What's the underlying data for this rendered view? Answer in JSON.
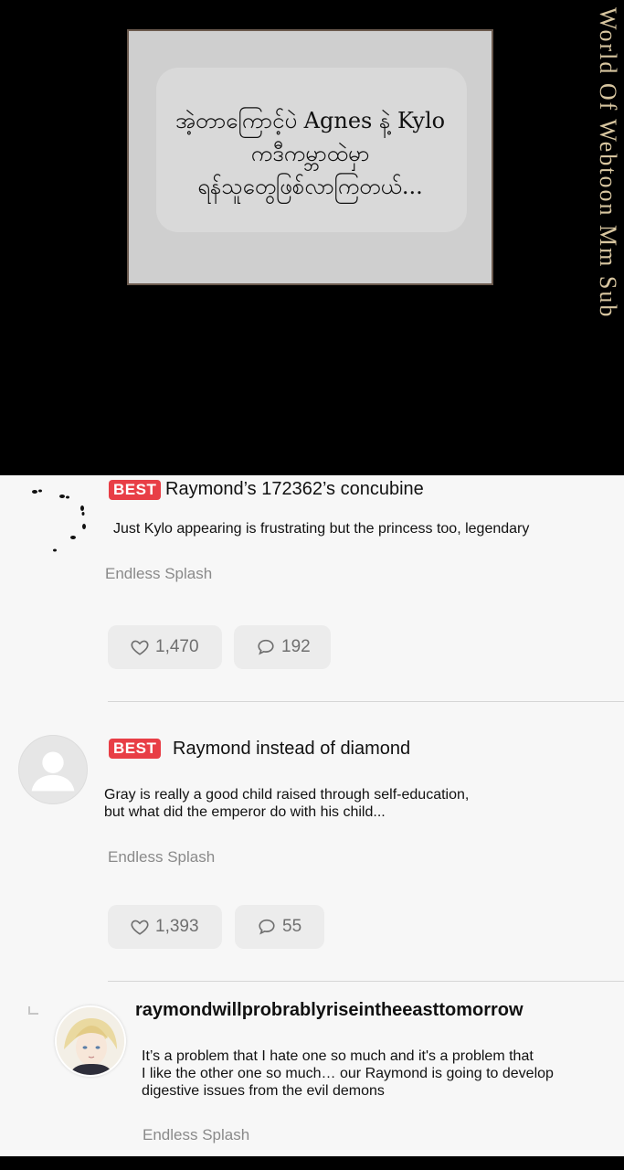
{
  "panel": {
    "caption": "အဲ့တာကြောင့်ပဲ Agnes နဲ့ Kylo\nကဒီကမ္ဘာထဲမှာ\nရန်သူတွေဖြစ်လာကြတယ်...",
    "watermark": "World Of Webtoon Mm Sub"
  },
  "comments": [
    {
      "badge": "BEST",
      "username": "Raymond’s 172362’s concubine",
      "text": "Just Kylo appearing is frustrating but the princess too, legendary",
      "source": "Endless Splash",
      "likes": "1,470",
      "replies": "192"
    },
    {
      "badge": "BEST",
      "username": "Raymond instead of diamond",
      "text": "Gray is really a good child raised through self-education,\nbut what did the emperor do with his child...",
      "source": "Endless Splash",
      "likes": "1,393",
      "replies": "55"
    },
    {
      "username": "raymondwillprobrablyriseintheeasttomorrow",
      "text": "It’s a problem that I hate one so much and it's a problem that\nI like the other one so much… our Raymond is going to develop\ndigestive issues from the evil demons",
      "source": "Endless Splash"
    }
  ],
  "icons": {
    "like": "heart-icon",
    "reply": "speech-bubble-icon",
    "reply_indicator": "reply-arrow-icon"
  },
  "colors": {
    "badge": "#e83e46",
    "watermark": "#d8c6a0",
    "caption_box": "#cfcfcf",
    "comments_bg": "#f7f7f7"
  }
}
